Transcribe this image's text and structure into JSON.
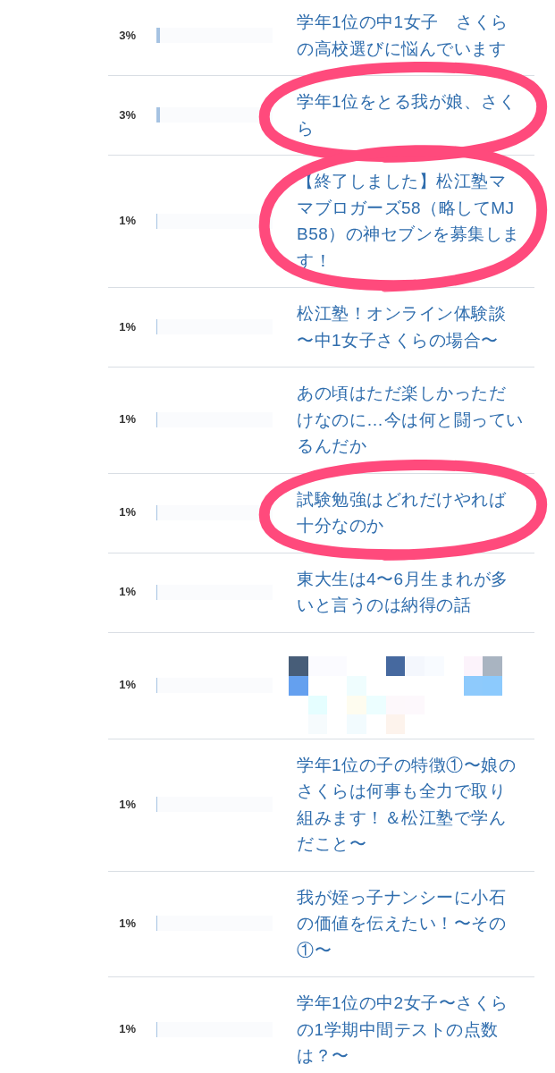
{
  "rows": [
    {
      "kind": "post",
      "percent": "3%",
      "level": 0.03,
      "circled": false,
      "title": "学年1位の中1女子　さくらの高校選びに悩んでいます"
    },
    {
      "kind": "post",
      "percent": "3%",
      "level": 0.03,
      "circled": true,
      "title": "学年1位をとる我が娘、さくら"
    },
    {
      "kind": "post",
      "percent": "1%",
      "level": 0.01,
      "circled": true,
      "title": "【終了しました】松江塾ママブロガーズ58（略してMJB58）の神セブンを募集します！"
    },
    {
      "kind": "post",
      "percent": "1%",
      "level": 0.01,
      "circled": false,
      "title": "松江塾！オンライン体験談〜中1女子さくらの場合〜"
    },
    {
      "kind": "post",
      "percent": "1%",
      "level": 0.01,
      "circled": false,
      "title": "あの頃はただ楽しかっただけなのに…今は何と闘っているんだか"
    },
    {
      "kind": "post",
      "percent": "1%",
      "level": 0.01,
      "circled": true,
      "title": "試験勉強はどれだけやれば十分なのか"
    },
    {
      "kind": "post",
      "percent": "1%",
      "level": 0.01,
      "circled": false,
      "title": "東大生は4〜6月生まれが多いと言うのは納得の話"
    },
    {
      "kind": "pixelated",
      "percent": "1%",
      "level": 0.01,
      "circled": false
    },
    {
      "kind": "post",
      "percent": "1%",
      "level": 0.01,
      "circled": false,
      "title": "学年1位の子の特徴①〜娘のさくらは何事も全力で取り組みます！＆松江塾で学んだこと〜"
    },
    {
      "kind": "post",
      "percent": "1%",
      "level": 0.01,
      "circled": false,
      "title": "我が姪っ子ナンシーに小石の価値を伝えたい！〜その①〜"
    },
    {
      "kind": "post",
      "percent": "1%",
      "level": 0.01,
      "circled": false,
      "title": "学年1位の中2女子〜さくらの1学期中間テストの点数は？〜"
    }
  ]
}
